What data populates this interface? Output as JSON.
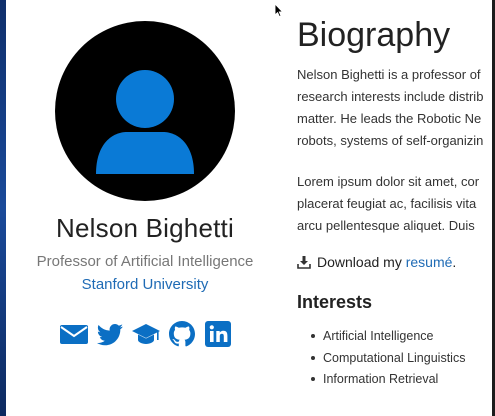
{
  "profile": {
    "name": "Nelson Bighetti",
    "role": "Professor of Artificial Intelligence",
    "organization": "Stanford University",
    "avatar_icon": "user-silhouette-icon",
    "socials": [
      {
        "icon": "envelope-icon"
      },
      {
        "icon": "twitter-icon"
      },
      {
        "icon": "graduation-cap-icon"
      },
      {
        "icon": "github-icon"
      },
      {
        "icon": "linkedin-icon"
      }
    ]
  },
  "biography": {
    "title": "Biography",
    "paragraph1": [
      "Nelson Bighetti is a professor of",
      "research interests include distrib",
      "matter. He leads the Robotic Ne",
      "robots, systems of self-organizin"
    ],
    "paragraph2": [
      "Lorem ipsum dolor sit amet, cor",
      "placerat feugiat ac, facilisis vita",
      "arcu pellentesque aliquet. Duis"
    ],
    "download_prefix": "Download my ",
    "download_link": "resumé",
    "download_suffix": "."
  },
  "interests": {
    "title": "Interests",
    "items": [
      "Artificial Intelligence",
      "Computational Linguistics",
      "Information Retrieval"
    ]
  },
  "colors": {
    "accent": "#1f6bb5",
    "icon_blue": "#0b6fc4",
    "avatar_fill": "#0a7ad6",
    "avatar_bg": "#000000"
  }
}
